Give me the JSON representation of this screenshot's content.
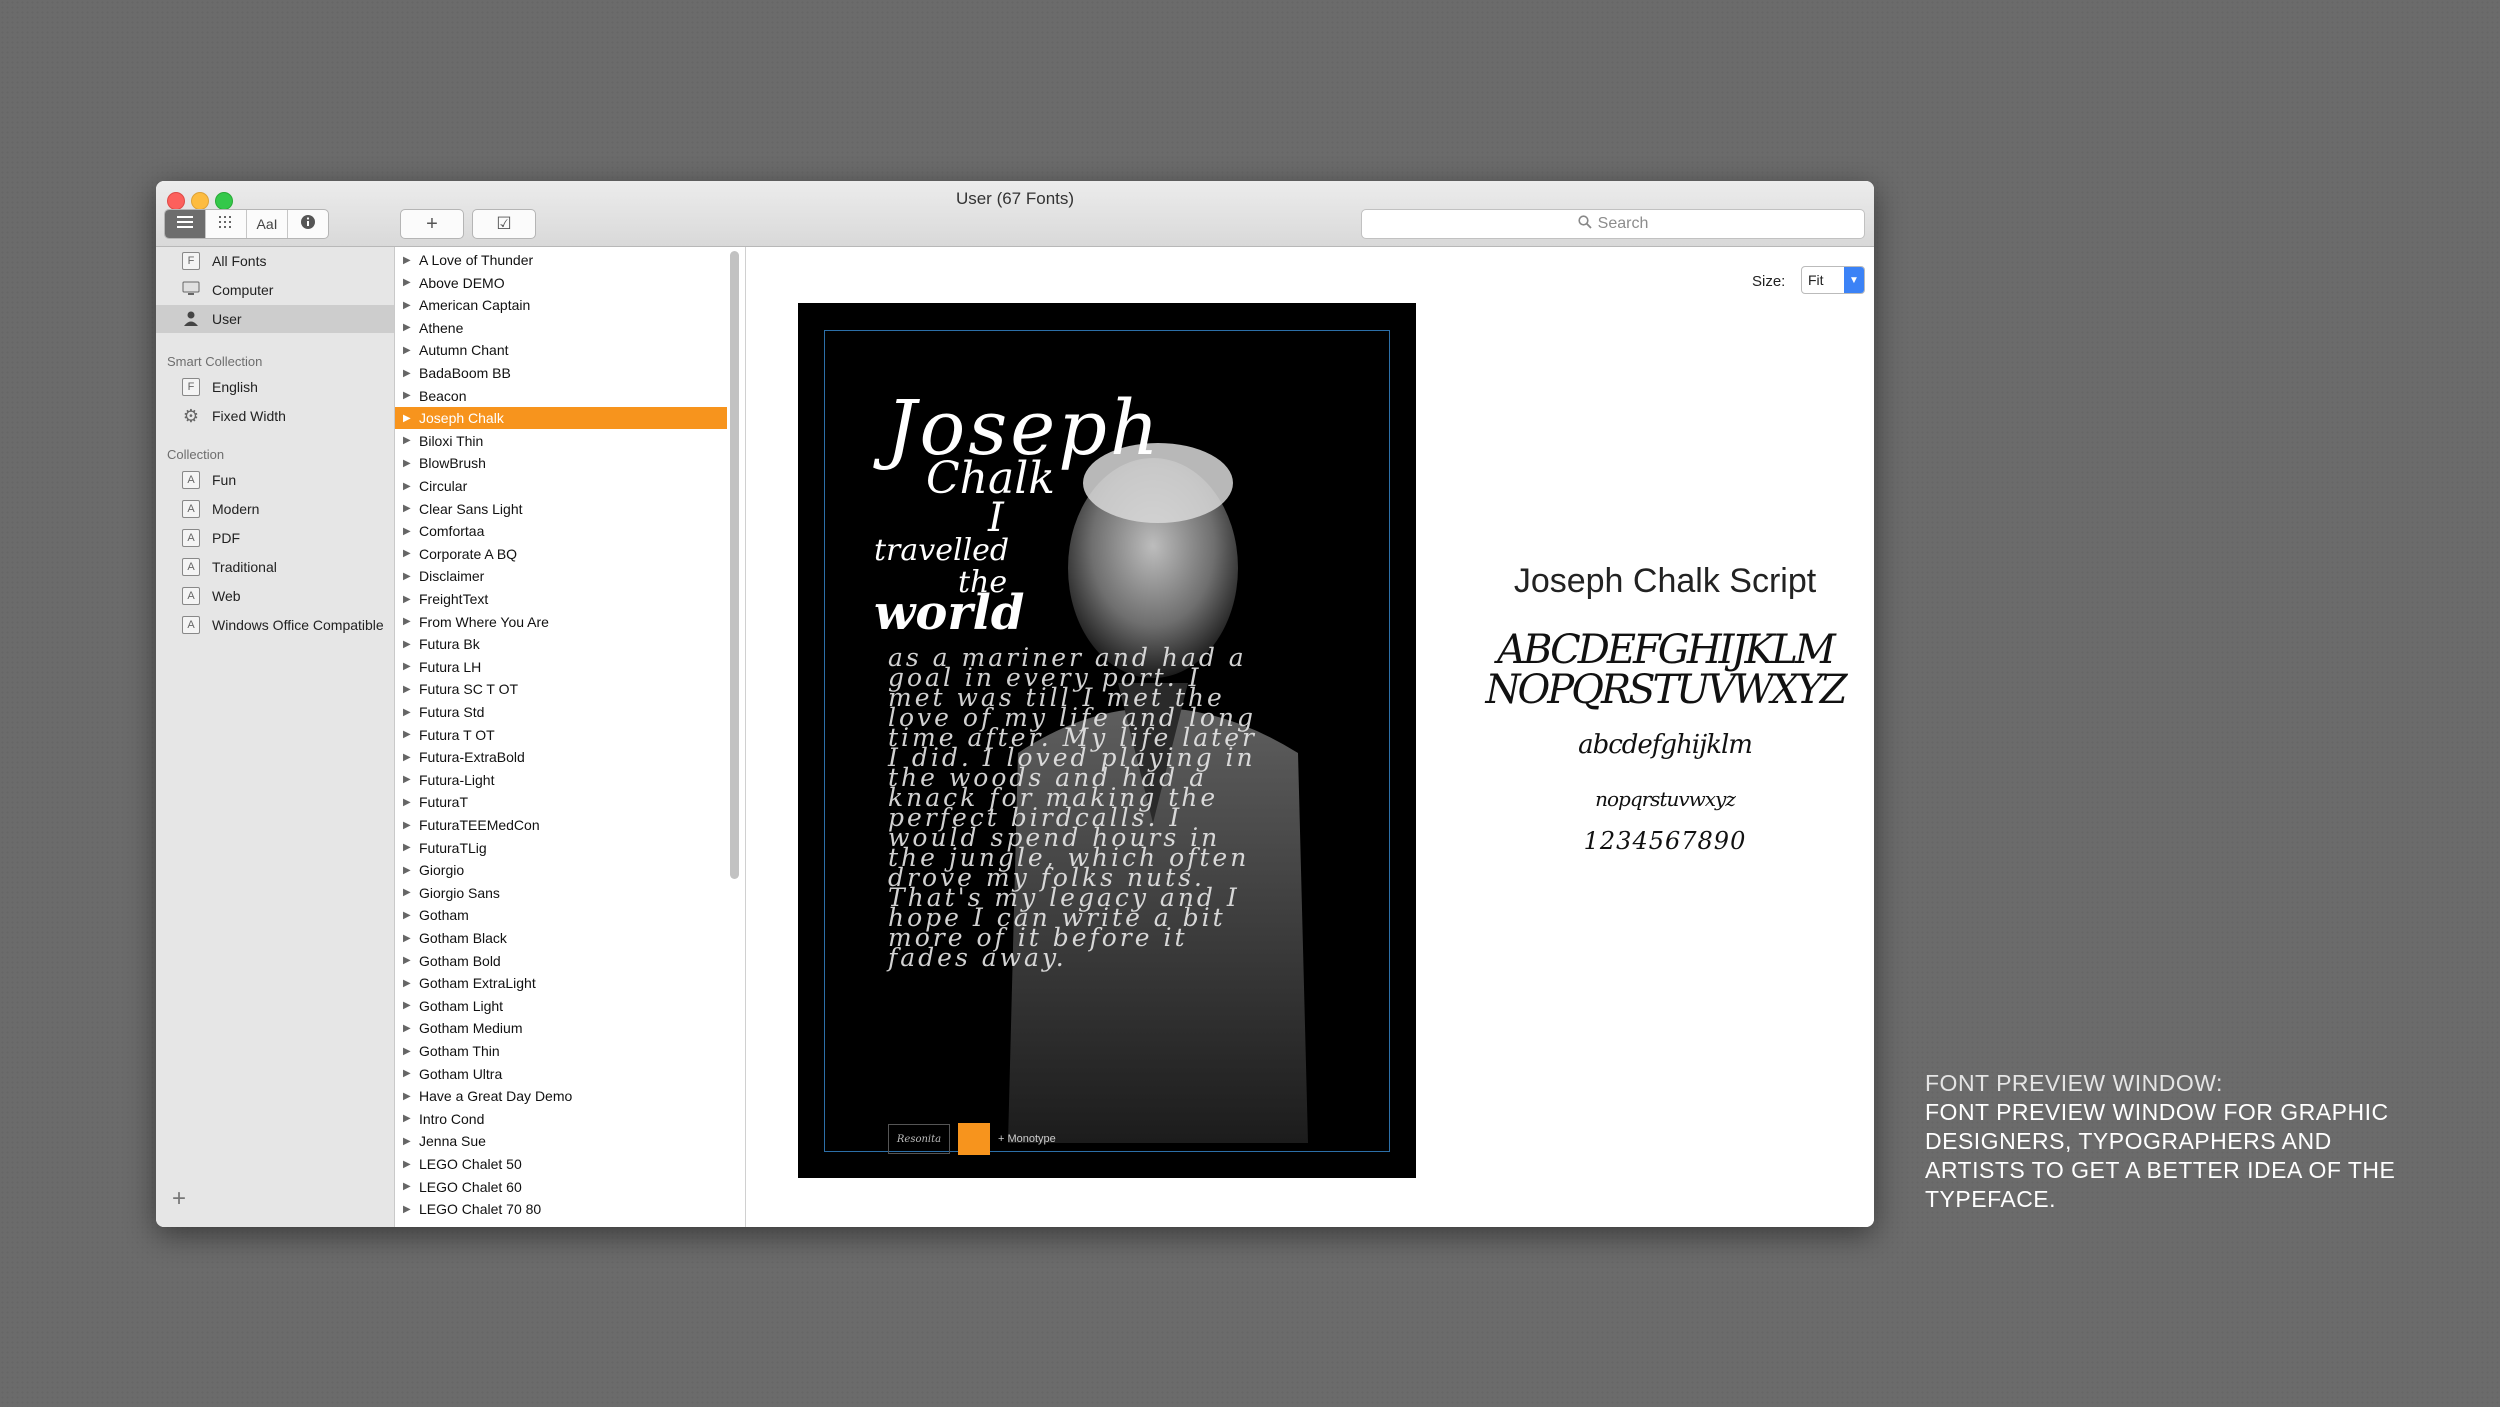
{
  "window": {
    "title": "User (67 Fonts)",
    "search_placeholder": "Search"
  },
  "toolbar": {
    "view_buttons": [
      {
        "icon": "list-lines-icon"
      },
      {
        "icon": "grid-icon"
      },
      {
        "label": "AaI",
        "icon": "font-sample-icon"
      },
      {
        "icon": "info-icon"
      }
    ],
    "add_label": "+",
    "validate_label": "☑"
  },
  "sidebar": {
    "library_items": [
      {
        "label": "All Fonts",
        "icon": "font-file-icon"
      },
      {
        "label": "Computer",
        "icon": "monitor-icon"
      },
      {
        "label": "User",
        "icon": "user-icon",
        "selected": true
      }
    ],
    "smart_collection_header": "Smart Collection",
    "smart_items": [
      {
        "label": "English",
        "icon": "font-file-icon"
      },
      {
        "label": "Fixed Width",
        "icon": "gear-icon"
      }
    ],
    "collection_header": "Collection",
    "collection_items": [
      {
        "label": "Fun",
        "icon": "font-file-icon"
      },
      {
        "label": "Modern",
        "icon": "font-file-icon"
      },
      {
        "label": "PDF",
        "icon": "font-file-icon"
      },
      {
        "label": "Traditional",
        "icon": "font-file-icon"
      },
      {
        "label": "Web",
        "icon": "font-file-icon"
      },
      {
        "label": "Windows Office Compatible",
        "icon": "font-file-icon"
      }
    ],
    "add_label": "+"
  },
  "font_list": {
    "selected_index": 7,
    "items": [
      "A Love of Thunder",
      "Above DEMO",
      "American Captain",
      "Athene",
      "Autumn Chant",
      "BadaBoom BB",
      "Beacon",
      "Joseph Chalk",
      "Biloxi Thin",
      "BlowBrush",
      "Circular",
      "Clear Sans Light",
      "Comfortaa",
      "Corporate A BQ",
      "Disclaimer",
      "FreightText",
      "From Where You Are",
      "Futura Bk",
      "Futura LH",
      "Futura SC T OT",
      "Futura Std",
      "Futura T OT",
      "Futura-ExtraBold",
      "Futura-Light",
      "FuturaT",
      "FuturaTEEMedCon",
      "FuturaTLig",
      "Giorgio",
      "Giorgio Sans",
      "Gotham",
      "Gotham Black",
      "Gotham Bold",
      "Gotham ExtraLight",
      "Gotham Light",
      "Gotham Medium",
      "Gotham Thin",
      "Gotham Ultra",
      "Have a Great Day Demo",
      "Intro Cond",
      "Jenna Sue",
      "LEGO Chalet 50",
      "LEGO Chalet 60",
      "LEGO Chalet 70 80"
    ]
  },
  "preview": {
    "size_label": "Size:",
    "size_value": "Fit",
    "poster": {
      "title_line1": "Joseph",
      "title_line2": "Chalk",
      "line_i": "I",
      "line_travelled": "travelled",
      "line_the": "the",
      "line_world": "world",
      "body": "as a mariner and had a goal in every port. I met was till I met the love of my life and long time after. My life later I did. I loved playing in the woods and had a knack for making the perfect birdcalls. I would spend hours in the jungle, which often drove my folks nuts. That's my legacy and I hope I can write a bit more of it before it fades away.",
      "footer_logo1": "Resonita",
      "footer_logo3": "+ Monotype"
    },
    "specimen": {
      "font_name": "Joseph Chalk Script",
      "uppercase1": "ABCDEFGHIJKLM",
      "uppercase2": "NOPQRSTUVWXYZ",
      "lowercase1": "abcdefghijklm",
      "lowercase2": "nopqrstuvwxyz",
      "digits": "1234567890"
    }
  },
  "caption": {
    "heading": "FONT PREVIEW WINDOW:",
    "body": "FONT PREVIEW WINDOW FOR GRAPHIC DESIGNERS, TYPOGRAPHERS AND ARTISTS TO GET A BETTER IDEA OF THE TYPEFACE."
  },
  "colors": {
    "accent_selection": "#f7941d",
    "sidebar_bg": "#e6e6e6",
    "desktop_bg": "#6b6b6b"
  }
}
